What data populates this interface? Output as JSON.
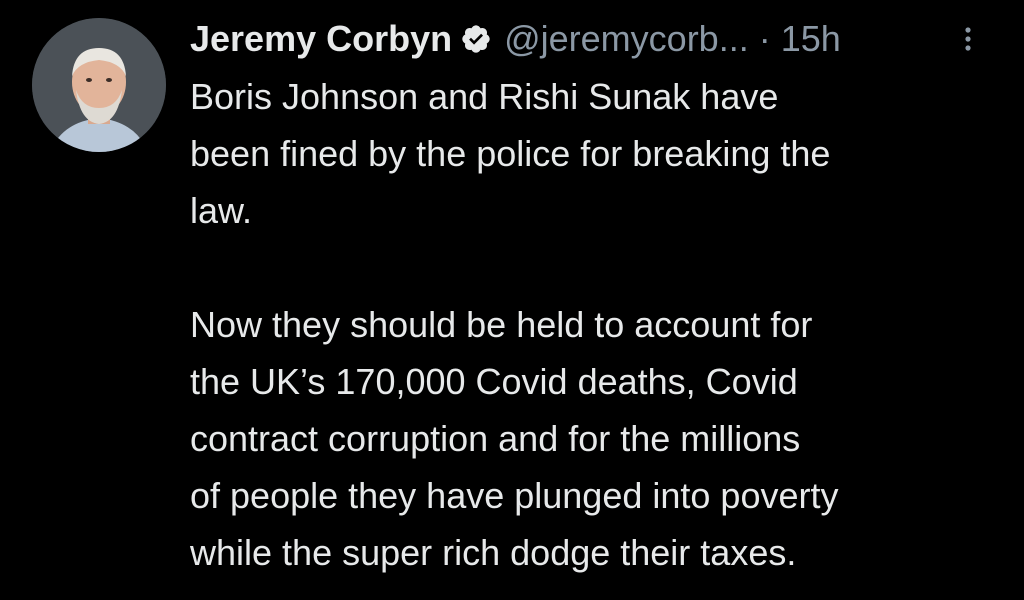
{
  "tweet": {
    "author": {
      "name": "Jeremy Corbyn",
      "handle": "@jeremycorb...",
      "verified": true
    },
    "separator": "·",
    "time": "15h",
    "paragraphs": [
      "Boris Johnson and Rishi Sunak have\nbeen fined by the police for breaking the\nlaw.",
      "Now they should be held to account for\nthe UK’s 170,000 Covid deaths, Covid\ncontract corruption and for the millions\nof people they have plunged into poverty\nwhile the super rich dodge their taxes."
    ]
  },
  "icons": {
    "verified": "verified-badge-icon",
    "more": "more-vertical-icon"
  },
  "colors": {
    "background": "#000000",
    "text": "#e7e9ea",
    "secondary": "#8b98a5"
  }
}
